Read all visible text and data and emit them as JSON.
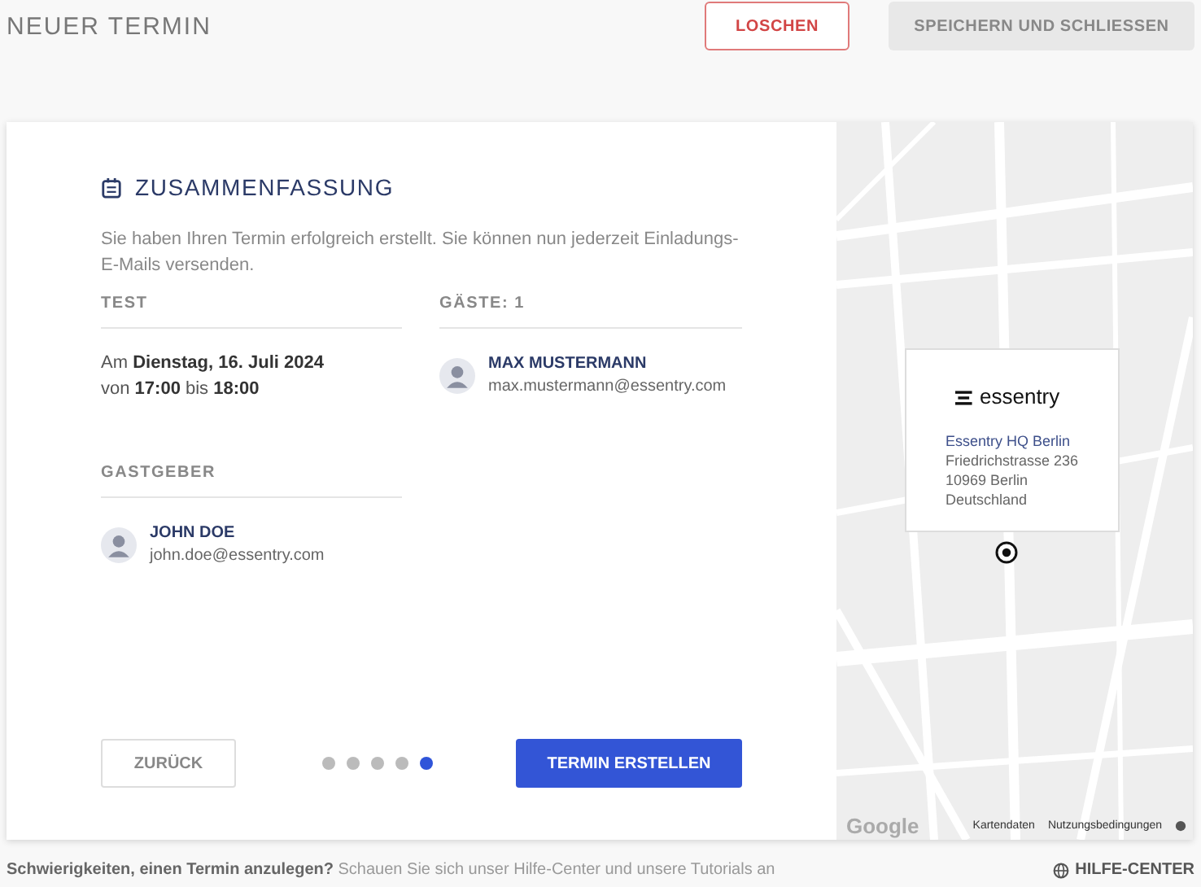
{
  "header": {
    "title": "NEUER TERMIN",
    "buttons": [
      {
        "label": "LOSCHEN",
        "kind": "danger"
      },
      {
        "label": "SPEICHERN UND SCHLIESSEN",
        "kind": "disabled"
      }
    ]
  },
  "summary": {
    "title": "ZUSAMMENFASSUNG",
    "intro": "Sie haben Ihren Termin erfolgreich erstellt. Sie können nun jederzeit Einladungs-E-Mails versenden.",
    "event": {
      "heading": "TEST",
      "date_line": "Am **Dienstag, 16. Juli 2024**",
      "time_line": "von **17:00** bis **18:00**"
    },
    "guests": {
      "heading": "GÄSTE: 1",
      "people": [
        {
          "name": "MAX MUSTERMANN",
          "email": "max.mustermann@essentry.com"
        }
      ]
    },
    "host": {
      "heading": "GASTGEBER",
      "people": [
        {
          "name": "JOHN DOE",
          "email": "john.doe@essentry.com"
        }
      ]
    }
  },
  "footer_nav": {
    "back": "ZURÜCK",
    "steps": [
      {
        "selected": false
      },
      {
        "selected": false
      },
      {
        "selected": false
      },
      {
        "selected": false
      },
      {
        "selected": true
      }
    ],
    "submit": "TERMIN ERSTELLEN"
  },
  "map": {
    "logo": "essentry",
    "place": "Essentry HQ Berlin",
    "address": [
      "Friedrichstrasse 236",
      "10969 Berlin",
      "Deutschland"
    ],
    "provider": "Google",
    "links": [
      "Kartendaten",
      "Nutzungsbedingungen"
    ]
  },
  "help": {
    "text": "**Schwierigkeiten, einen Termin anzulegen?** Schauen Sie sich unser Hilfe-Center und unsere Tutorials an",
    "link": "HILFE-CENTER"
  }
}
